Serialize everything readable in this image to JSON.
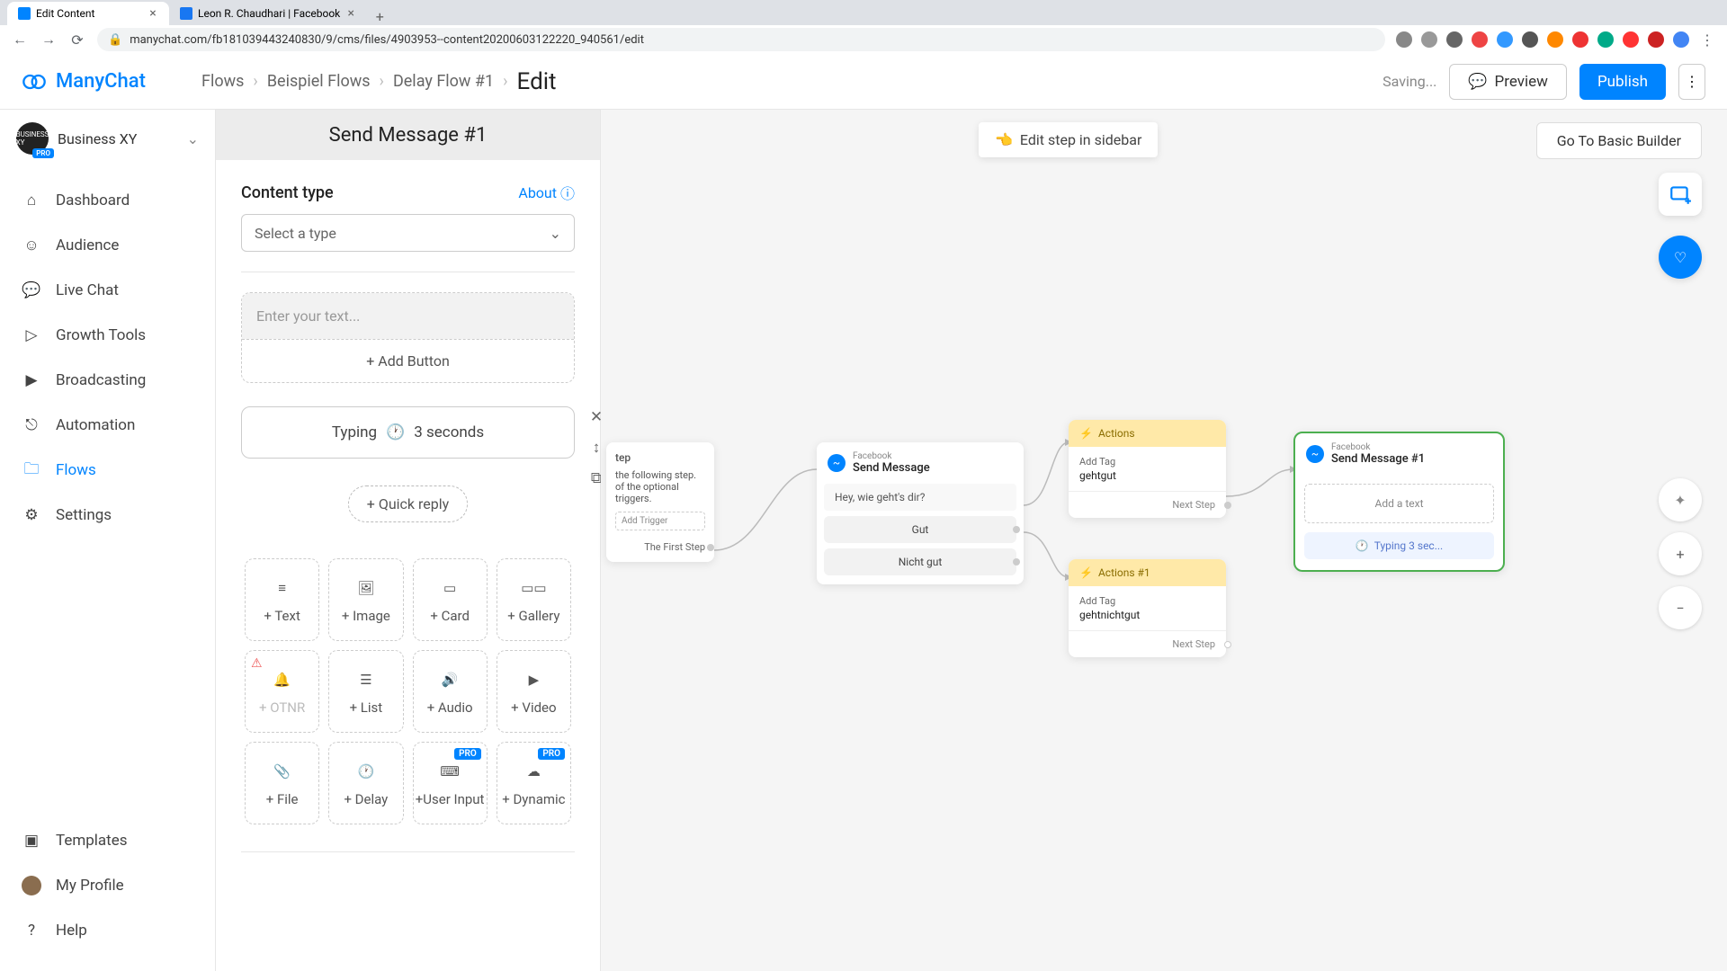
{
  "browser": {
    "tabs": [
      {
        "title": "Edit Content",
        "active": true
      },
      {
        "title": "Leon R. Chaudhari | Facebook",
        "active": false
      }
    ],
    "url": "manychat.com/fb181039443240830/9/cms/files/4903953--content20200603122220_940561/edit"
  },
  "logo": "ManyChat",
  "breadcrumbs": {
    "items": [
      "Flows",
      "Beispiel Flows",
      "Delay Flow #1"
    ],
    "current": "Edit"
  },
  "header": {
    "saving": "Saving...",
    "preview": "Preview",
    "publish": "Publish"
  },
  "workspace": {
    "name": "Business XY",
    "badge": "PRO",
    "avatar": "BUSINESS XY"
  },
  "nav": {
    "items": [
      "Dashboard",
      "Audience",
      "Live Chat",
      "Growth Tools",
      "Broadcasting",
      "Automation",
      "Flows",
      "Settings"
    ],
    "bottom": [
      "Templates",
      "My Profile",
      "Help"
    ],
    "active": "Flows"
  },
  "panel": {
    "title": "Send Message #1",
    "content_type_label": "Content type",
    "about": "About",
    "select_placeholder": "Select a type",
    "text_placeholder": "Enter your text...",
    "add_button": "+ Add Button",
    "typing_label": "Typing",
    "typing_value": "3 seconds",
    "quick_reply": "+ Quick reply"
  },
  "palette": [
    {
      "label": "+ Text"
    },
    {
      "label": "+ Image"
    },
    {
      "label": "+ Card"
    },
    {
      "label": "+ Gallery"
    },
    {
      "label": "+ OTNR",
      "disabled": true,
      "warn": true
    },
    {
      "label": "+ List"
    },
    {
      "label": "+ Audio"
    },
    {
      "label": "+ Video"
    },
    {
      "label": "+ File"
    },
    {
      "label": "+ Delay"
    },
    {
      "label": "+User Input",
      "pro": true
    },
    {
      "label": "+ Dynamic",
      "pro": true
    }
  ],
  "canvas": {
    "edit_sidebar": "Edit step in sidebar",
    "basic_builder": "Go To Basic Builder",
    "trigger": {
      "title": "tep",
      "desc1": "the following step.",
      "desc2": "of the optional triggers.",
      "add_trigger": "Add Trigger",
      "first_step": "The First Step"
    },
    "send": {
      "platform": "Facebook",
      "title": "Send Message",
      "msg": "Hey, wie geht's dir?",
      "opt1": "Gut",
      "opt2": "Nicht gut"
    },
    "actions1": {
      "title": "Actions",
      "add_tag": "Add Tag",
      "tag": "gehtgut",
      "next": "Next Step"
    },
    "actions2": {
      "title": "Actions #1",
      "add_tag": "Add Tag",
      "tag": "gehtnichtgut",
      "next": "Next Step"
    },
    "send2": {
      "platform": "Facebook",
      "title": "Send Message #1",
      "add_text": "Add a text",
      "typing": "Typing 3 sec..."
    }
  }
}
